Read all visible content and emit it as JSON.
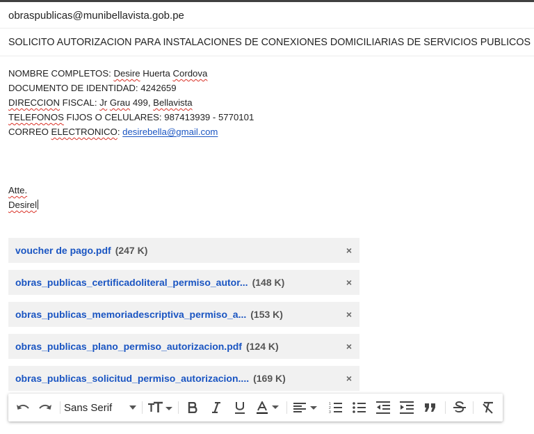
{
  "compose": {
    "to": "obraspublicas@munibellavista.gob.pe",
    "subject": "SOLICITO AUTORIZACION PARA INSTALACIONES DE CONEXIONES DOMICILIARIAS DE SERVICIOS PUBLICOS"
  },
  "body": {
    "line1": {
      "label": "NOMBRE COMPLETOS: ",
      "w1": "Desire",
      "mid": " Huerta ",
      "w2": "Cordova"
    },
    "line2": {
      "text": "DOCUMENTO DE IDENTIDAD: 4242659"
    },
    "line3": {
      "w1": "DIRECCION",
      "mid": " FISCAL: ",
      "w2": "Jr",
      "sp": " ",
      "w3": "Grau",
      "mid2": " 499, ",
      "w4": "Bellavista"
    },
    "line4": {
      "w1": "TELEFONOS",
      "rest": " FIJOS O CELULARES: 987413939 - 5770101"
    },
    "line5": {
      "pre": "CORREO ",
      "w1": "ELECTRONICO",
      "colon": ": ",
      "email": "desirebella@gmail.com"
    },
    "sign1": "Atte.",
    "sign2": "Desirel"
  },
  "attachments": [
    {
      "name": "voucher de pago.pdf",
      "size": "(247 K)"
    },
    {
      "name": "obras_publicas_certificadoliteral_permiso_autor...",
      "size": "(148 K)"
    },
    {
      "name": "obras_publicas_memoriadescriptiva_permiso_a...",
      "size": "(153 K)"
    },
    {
      "name": "obras_publicas_plano_permiso_autorizacion.pdf",
      "size": "(124 K)"
    },
    {
      "name": "obras_publicas_solicitud_permiso_autorizacion....",
      "size": "(169 K)"
    }
  ],
  "attachment_remove_glyph": "×",
  "toolbar": {
    "font": "Sans Serif",
    "icons": [
      "undo-icon",
      "redo-icon",
      "font-dropdown",
      "text-size-icon",
      "bold-icon",
      "italic-icon",
      "underline-icon",
      "text-color-icon",
      "align-icon",
      "numbered-list-icon",
      "bulleted-list-icon",
      "indent-less-icon",
      "indent-more-icon",
      "quote-icon",
      "strikethrough-icon",
      "remove-formatting-icon"
    ]
  },
  "colors": {
    "link": "#1a55c2",
    "spell_underline": "#d93025",
    "chip_bg": "#f1f1f1"
  }
}
